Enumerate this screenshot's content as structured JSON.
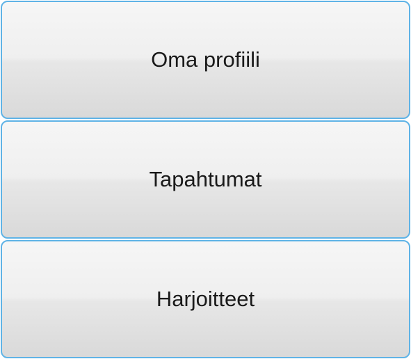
{
  "menu": {
    "items": [
      {
        "label": "Oma profiili"
      },
      {
        "label": "Tapahtumat"
      },
      {
        "label": "Harjoitteet"
      }
    ]
  }
}
